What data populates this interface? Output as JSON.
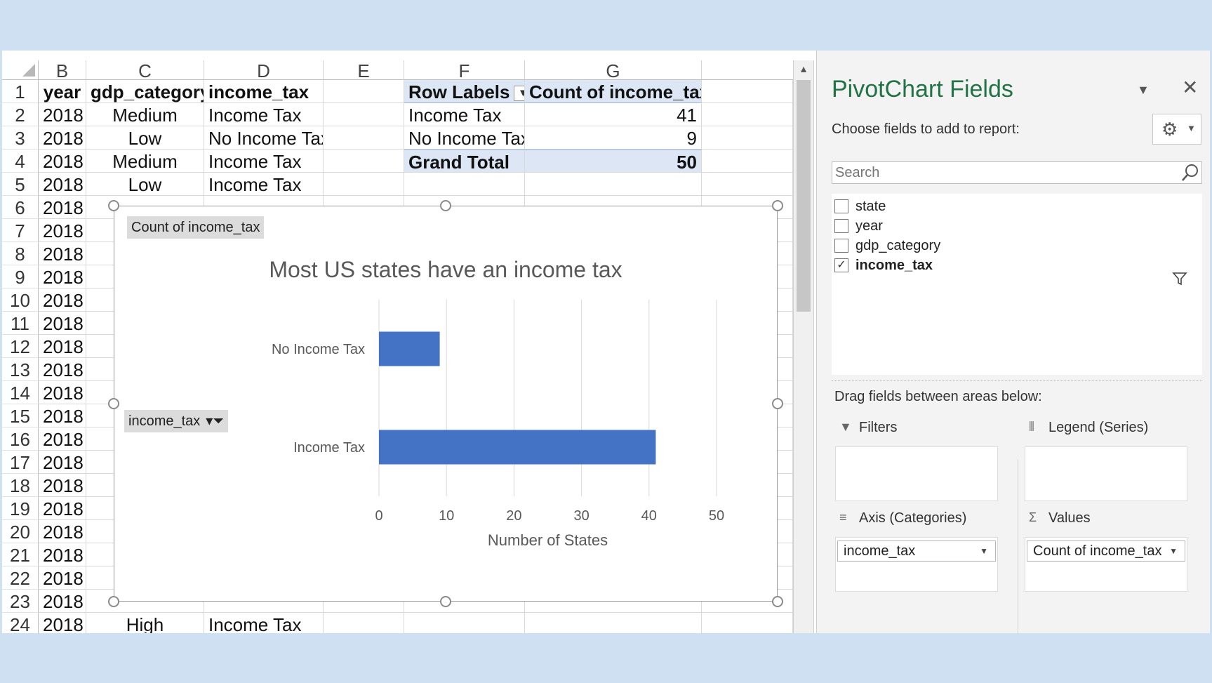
{
  "columns": [
    "B",
    "C",
    "D",
    "E",
    "F",
    "G"
  ],
  "rows": [
    {
      "n": "1",
      "b": "year",
      "c": "gdp_category",
      "d": "income_tax"
    },
    {
      "n": "2",
      "b": "2018",
      "c": "Medium",
      "d": "Income Tax"
    },
    {
      "n": "3",
      "b": "2018",
      "c": "Low",
      "d": "No Income Tax"
    },
    {
      "n": "4",
      "b": "2018",
      "c": "Medium",
      "d": "Income Tax"
    },
    {
      "n": "5",
      "b": "2018",
      "c": "Low",
      "d": "Income Tax"
    },
    {
      "n": "6",
      "b": "2018",
      "c": "",
      "d": ""
    },
    {
      "n": "7",
      "b": "2018",
      "c": "",
      "d": ""
    },
    {
      "n": "8",
      "b": "2018",
      "c": "",
      "d": ""
    },
    {
      "n": "9",
      "b": "2018",
      "c": "",
      "d": ""
    },
    {
      "n": "10",
      "b": "2018",
      "c": "",
      "d": ""
    },
    {
      "n": "11",
      "b": "2018",
      "c": "",
      "d": ""
    },
    {
      "n": "12",
      "b": "2018",
      "c": "",
      "d": ""
    },
    {
      "n": "13",
      "b": "2018",
      "c": "",
      "d": ""
    },
    {
      "n": "14",
      "b": "2018",
      "c": "",
      "d": ""
    },
    {
      "n": "15",
      "b": "2018",
      "c": "",
      "d": ""
    },
    {
      "n": "16",
      "b": "2018",
      "c": "",
      "d": ""
    },
    {
      "n": "17",
      "b": "2018",
      "c": "",
      "d": ""
    },
    {
      "n": "18",
      "b": "2018",
      "c": "",
      "d": ""
    },
    {
      "n": "19",
      "b": "2018",
      "c": "",
      "d": ""
    },
    {
      "n": "20",
      "b": "2018",
      "c": "",
      "d": ""
    },
    {
      "n": "21",
      "b": "2018",
      "c": "",
      "d": ""
    },
    {
      "n": "22",
      "b": "2018",
      "c": "",
      "d": ""
    },
    {
      "n": "23",
      "b": "2018",
      "c": "",
      "d": ""
    },
    {
      "n": "24",
      "b": "2018",
      "c": "High",
      "d": "Income Tax"
    }
  ],
  "pivot": {
    "header_row_labels": "Row Labels",
    "header_count": "Count of income_tax",
    "rows": [
      {
        "label": "Income Tax",
        "value": "41"
      },
      {
        "label": "No Income Tax",
        "value": "9"
      }
    ],
    "total_label": "Grand Total",
    "total_value": "50"
  },
  "chart_buttons": {
    "values_field": "Count of income_tax",
    "axis_field": "income_tax"
  },
  "chart_data": {
    "type": "bar",
    "orientation": "horizontal",
    "title": "Most US states have an income tax",
    "categories": [
      "Income Tax",
      "No Income Tax"
    ],
    "values": [
      41,
      9
    ],
    "xlabel": "Number of States",
    "ylabel": "",
    "xlim": [
      0,
      50
    ],
    "xticks": [
      "0",
      "10",
      "20",
      "30",
      "40",
      "50"
    ],
    "grid": true,
    "bar_color": "#4472C4"
  },
  "pane": {
    "title": "PivotChart Fields",
    "choose_label": "Choose fields to add to report:",
    "search_placeholder": "Search",
    "fields": [
      {
        "name": "state",
        "checked": false
      },
      {
        "name": "year",
        "checked": false
      },
      {
        "name": "gdp_category",
        "checked": false
      },
      {
        "name": "income_tax",
        "checked": true
      }
    ],
    "drag_label": "Drag fields between areas below:",
    "areas": {
      "filters": "Filters",
      "legend": "Legend (Series)",
      "axis": "Axis (Categories)",
      "values": "Values",
      "axis_item": "income_tax",
      "values_item": "Count of income_tax"
    },
    "accent_color": "#217346"
  }
}
